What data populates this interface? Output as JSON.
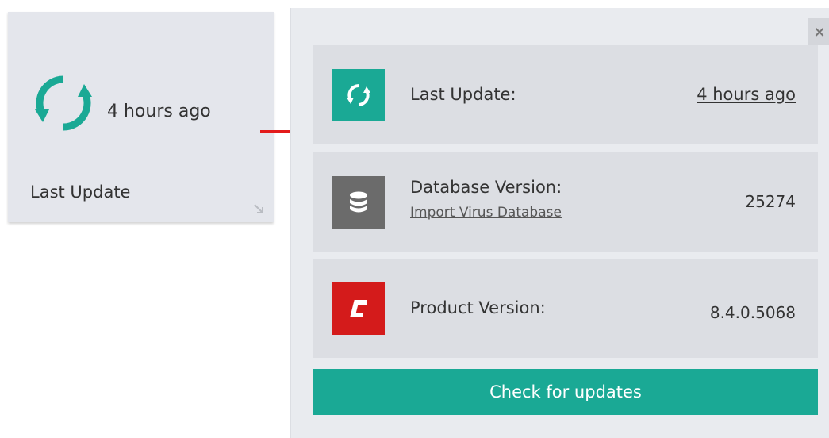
{
  "tile": {
    "time": "4 hours ago",
    "label": "Last Update"
  },
  "panel": {
    "close_label": "×",
    "rows": [
      {
        "label": "Last Update:",
        "value": "4 hours ago",
        "icon": "refresh-icon",
        "color": "#1aa995"
      },
      {
        "label": "Database Version:",
        "sublink": "Import Virus Database",
        "value": "25274",
        "icon": "database-icon",
        "color": "#6b6b6b"
      },
      {
        "label": "Product Version:",
        "value": "8.4.0.5068",
        "icon": "comodo-logo-icon",
        "color": "#d41b1b"
      }
    ],
    "button_label": "Check for updates"
  },
  "colors": {
    "accent": "#1aa995",
    "arrow": "#e31b1b"
  }
}
